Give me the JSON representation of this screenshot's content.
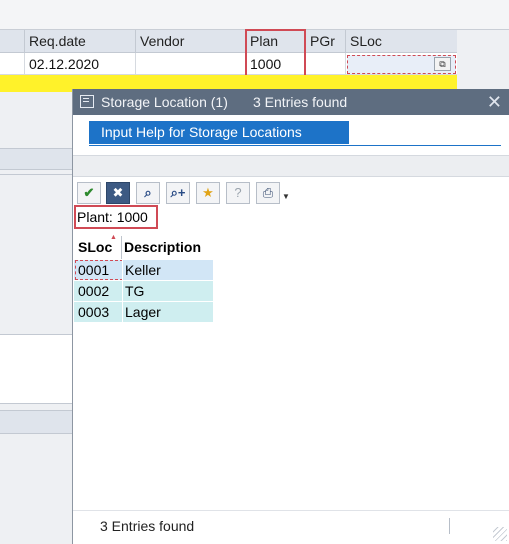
{
  "background_table": {
    "columns": [
      {
        "id": "req-date",
        "label": "Req.date"
      },
      {
        "id": "vendor",
        "label": "Vendor"
      },
      {
        "id": "plant",
        "label": "Plan"
      },
      {
        "id": "pgr",
        "label": "PGr"
      },
      {
        "id": "sloc",
        "label": "SLoc"
      }
    ],
    "row": {
      "req_date": "02.12.2020",
      "vendor": "",
      "plant": "1000",
      "pgr": "",
      "sloc": ""
    },
    "f4_icon": "value-help-icon"
  },
  "dialog": {
    "title": "Storage Location (1)",
    "entries_found": "3 Entries found",
    "close_glyph": "✕",
    "tab_label": "Input Help for Storage Locations",
    "toolbar": [
      {
        "name": "confirm-button",
        "icon": "check-icon",
        "glyph": "✔"
      },
      {
        "name": "cancel-button",
        "icon": "cancel-icon",
        "glyph": "✖"
      },
      {
        "name": "find-button",
        "icon": "binoculars-icon",
        "glyph": "⌕"
      },
      {
        "name": "find-next-button",
        "icon": "binoculars-plus-icon",
        "glyph": "⌕+"
      },
      {
        "name": "add-favorite-button",
        "icon": "star-add-icon",
        "glyph": "★"
      },
      {
        "name": "help-button",
        "icon": "help-icon",
        "glyph": "?"
      },
      {
        "name": "print-button",
        "icon": "printer-icon",
        "glyph": "⎙"
      }
    ],
    "plant_restriction": "Plant: 1000",
    "results": {
      "headers": [
        "SLoc",
        "Description"
      ],
      "rows": [
        {
          "sloc": "0001",
          "description": "Keller"
        },
        {
          "sloc": "0002",
          "description": "TG"
        },
        {
          "sloc": "0003",
          "description": "Lager"
        }
      ]
    },
    "status_text": "3 Entries found"
  },
  "colors": {
    "titlebar": "#5e6d80",
    "tab_accent": "#1d73c8",
    "highlight_box": "#d04a55",
    "row_teal": "#cfeef0",
    "row_selected": "#d2e6f6",
    "yellow_band": "#fff22a"
  }
}
